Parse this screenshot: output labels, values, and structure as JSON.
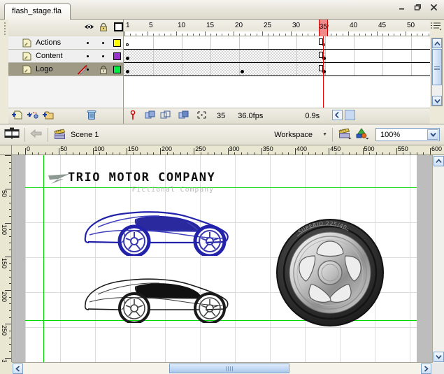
{
  "window": {
    "document_tab": "flash_stage.fla",
    "minimize_label": "–",
    "restore_label": "❐",
    "close_label": "✕"
  },
  "timeline": {
    "header_icons": [
      "eye-icon",
      "lock-icon",
      "outline-square-icon"
    ],
    "layers": [
      {
        "name": "Actions",
        "color": "#ffff00",
        "visible": true,
        "locked": false,
        "selected": false
      },
      {
        "name": "Content",
        "color": "#9933cc",
        "visible": true,
        "locked": false,
        "selected": false
      },
      {
        "name": "Logo",
        "color": "#00ee44",
        "visible": true,
        "locked": true,
        "selected": true
      }
    ],
    "layer_tools": [
      "insert-layer-icon",
      "add-motion-guide-icon",
      "insert-folder-icon",
      "delete-layer-icon"
    ],
    "ruler_marks": [
      1,
      5,
      10,
      15,
      20,
      25,
      30,
      35,
      40,
      45,
      50
    ],
    "playhead_frame": 35,
    "frame_rows": [
      {
        "layer": "Actions",
        "shaded": false,
        "keyframes": [
          {
            "frame": 1,
            "type": "hollow"
          },
          {
            "frame": 35,
            "type": "hollow"
          }
        ],
        "span_end": 35
      },
      {
        "layer": "Content",
        "shaded": true,
        "keyframes": [
          {
            "frame": 1,
            "type": "filled"
          },
          {
            "frame": 35,
            "type": "filled"
          }
        ],
        "span_end": 35
      },
      {
        "layer": "Logo",
        "shaded": true,
        "keyframes": [
          {
            "frame": 1,
            "type": "filled"
          },
          {
            "frame": 21,
            "type": "filled"
          },
          {
            "frame": 35,
            "type": "filled"
          }
        ],
        "span_end": 35
      }
    ],
    "footer": {
      "onion_icons": [
        "center-frame-icon",
        "onion-skin-icon",
        "onion-skin-outlines-icon",
        "edit-multiple-frames-icon",
        "modify-onion-markers-icon"
      ],
      "current_frame": "35",
      "frame_rate": "36.0fps",
      "elapsed_time": "0.9s"
    },
    "options_icon": "timeline-options-icon"
  },
  "editbar": {
    "timeline_toggle_icon": "timeline-icon",
    "back_icon": "back-arrow-icon",
    "scene_icon": "scene-icon",
    "scene_name": "Scene 1",
    "workspace_label": "Workspace",
    "edit_scene_icon": "edit-scene-icon",
    "edit_symbol_icon": "edit-symbol-icon",
    "zoom_value": "100%"
  },
  "stage": {
    "h_ruler_labels": [
      0,
      50,
      100,
      150,
      200,
      250,
      300,
      350,
      400,
      450,
      500,
      550
    ],
    "v_ruler_labels": [
      50,
      100,
      150,
      200,
      250
    ],
    "guide_color": "#00d800",
    "logo": {
      "title": "TRIO MOTOR COMPANY",
      "subtitle": "Fictional Company"
    },
    "artwork": {
      "car_blue_color": "#2222aa",
      "car_gray_color": "#222222",
      "wheel_sidewall_text": "SUPERIO 225/40-18"
    }
  },
  "scrollbars": {
    "up_arrow": "▲",
    "down_arrow": "▼",
    "left_arrow": "◀",
    "right_arrow": "▶"
  }
}
